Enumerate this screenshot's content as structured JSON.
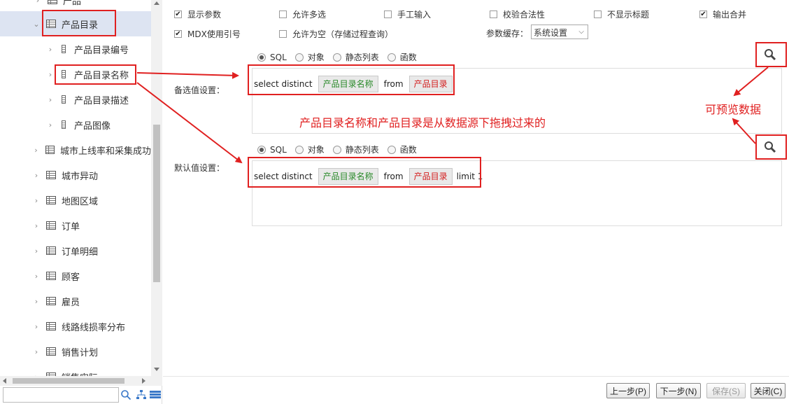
{
  "sidebar": {
    "items": [
      {
        "label": "产品",
        "type": "table",
        "chevron": "›",
        "expanded": false,
        "indent": 0
      },
      {
        "label": "产品目录",
        "type": "table",
        "chevron": "⌄",
        "expanded": true,
        "selected": true,
        "indent": 0
      },
      {
        "label": "产品目录编号",
        "type": "field",
        "chevron": "›",
        "indent": 1
      },
      {
        "label": "产品目录名称",
        "type": "field",
        "chevron": "›",
        "indent": 1
      },
      {
        "label": "产品目录描述",
        "type": "field",
        "chevron": "›",
        "indent": 1
      },
      {
        "label": "产品图像",
        "type": "field",
        "chevron": "›",
        "indent": 1
      },
      {
        "label": "城市上线率和采集成功",
        "type": "table",
        "chevron": "›",
        "indent": 0
      },
      {
        "label": "城市异动",
        "type": "table",
        "chevron": "›",
        "indent": 0
      },
      {
        "label": "地图区域",
        "type": "table",
        "chevron": "›",
        "indent": 0
      },
      {
        "label": "订单",
        "type": "table",
        "chevron": "›",
        "indent": 0
      },
      {
        "label": "订单明细",
        "type": "table",
        "chevron": "›",
        "indent": 0
      },
      {
        "label": "顾客",
        "type": "table",
        "chevron": "›",
        "indent": 0
      },
      {
        "label": "雇员",
        "type": "table",
        "chevron": "›",
        "indent": 0
      },
      {
        "label": "线路线损率分布",
        "type": "table",
        "chevron": "›",
        "indent": 0
      },
      {
        "label": "销售计划",
        "type": "table",
        "chevron": "›",
        "indent": 0
      },
      {
        "label": "销售实际",
        "type": "table",
        "chevron": "›",
        "indent": 0
      }
    ],
    "search_placeholder": ""
  },
  "options": {
    "show_param": {
      "label": "显示参数",
      "checked": true
    },
    "allow_multi": {
      "label": "允许多选",
      "checked": false
    },
    "manual_input": {
      "label": "手工输入",
      "checked": false
    },
    "validate": {
      "label": "校验合法性",
      "checked": false
    },
    "hide_title": {
      "label": "不显示标题",
      "checked": false
    },
    "output_merge": {
      "label": "输出合并",
      "checked": true
    },
    "mdx_quote": {
      "label": "MDX使用引号",
      "checked": true
    },
    "allow_empty": {
      "label": "允许为空（存储过程查询）",
      "checked": false
    },
    "cache_label": "参数缓存：",
    "cache_value": "系统设置"
  },
  "candidate": {
    "label": "备选值设置：",
    "radios": [
      "SQL",
      "对象",
      "静态列表",
      "函数"
    ],
    "selected_radio": "SQL",
    "sql": {
      "prefix": "select distinct",
      "field_chip": "产品目录名称",
      "from": "from",
      "table_chip": "产品目录",
      "suffix": ""
    }
  },
  "default": {
    "label": "默认值设置：",
    "radios": [
      "SQL",
      "对象",
      "静态列表",
      "函数"
    ],
    "selected_radio": "SQL",
    "sql": {
      "prefix": "select distinct",
      "field_chip": "产品目录名称",
      "from": "from",
      "table_chip": "产品目录",
      "suffix": "limit 1"
    }
  },
  "annotations": {
    "drag_note": "产品目录名称和产品目录是从数据源下拖拽过来的",
    "preview_note": "可预览数据"
  },
  "buttons": {
    "prev": "上一步(P)",
    "next": "下一步(N)",
    "save": "保存(S)",
    "close": "关闭(C)"
  },
  "colors": {
    "annotation_red": "#e02020",
    "chip_green_text": "#2a8a2a",
    "chip_red_text": "#d42020",
    "selected_row_bg": "#dde4f2"
  }
}
